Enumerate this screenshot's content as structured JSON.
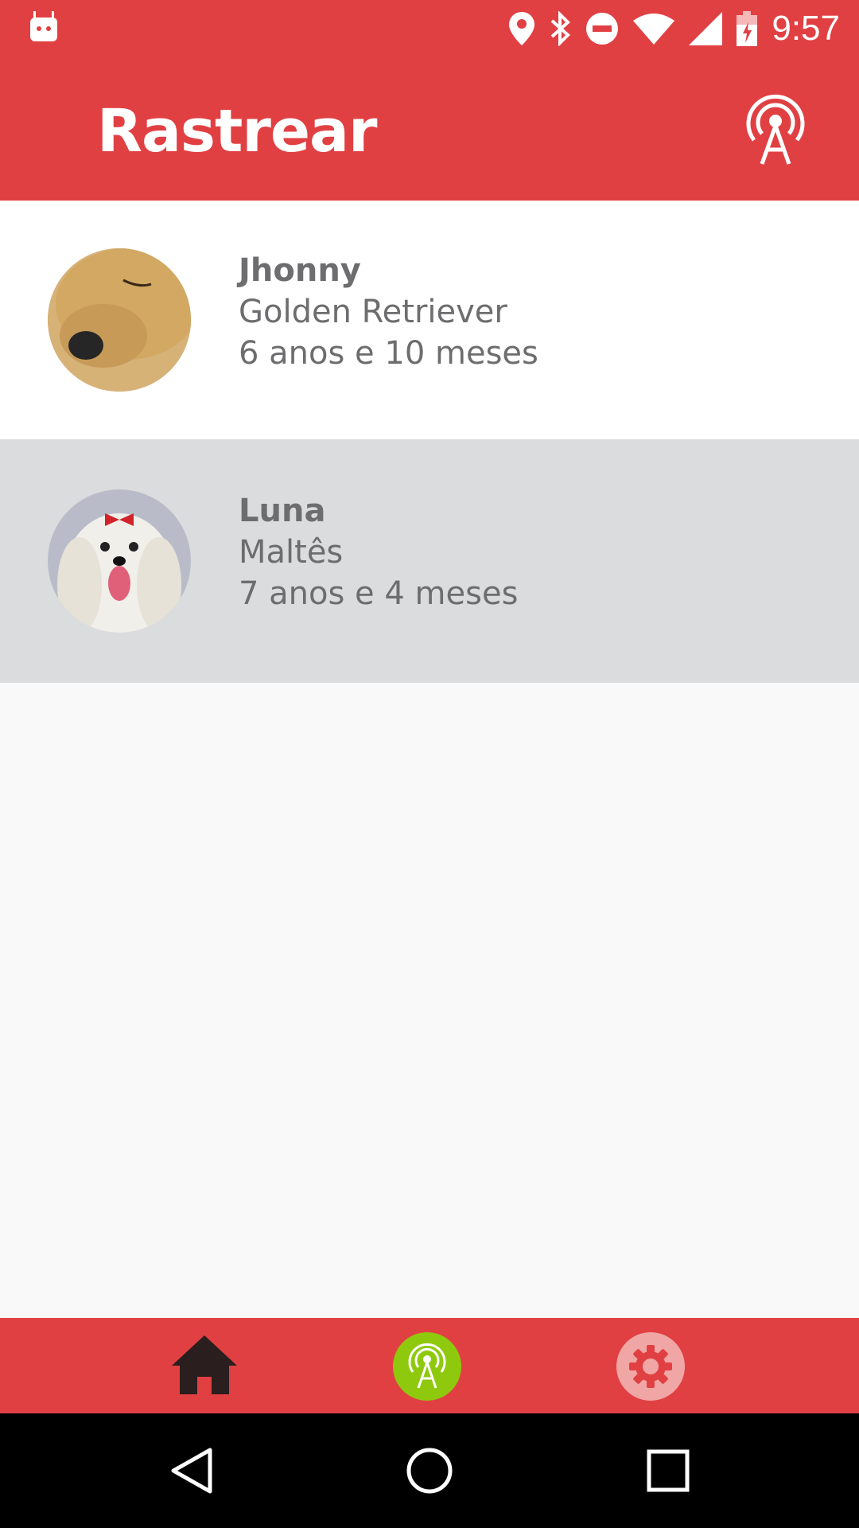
{
  "status_bar": {
    "time": "9:57",
    "icons": [
      "android-icon",
      "location-icon",
      "bluetooth-icon",
      "do-not-disturb-icon",
      "wifi-icon",
      "signal-icon",
      "battery-charging-icon"
    ]
  },
  "app_bar": {
    "title": "Rastrear",
    "action_icon": "antenna-icon"
  },
  "pets": [
    {
      "name": "Jhonny",
      "breed": "Golden Retriever",
      "age": "6 anos e 10 meses"
    },
    {
      "name": "Luna",
      "breed": "Maltês",
      "age": "7 anos e 4 meses"
    }
  ],
  "bottom_nav": {
    "items": [
      "home-icon",
      "antenna-icon",
      "gear-icon"
    ],
    "active": "antenna-icon"
  },
  "colors": {
    "primary": "#e14043",
    "active_nav": "#8ec90e",
    "selected_row": "#dbdcde",
    "text": "#6d6d6f"
  }
}
